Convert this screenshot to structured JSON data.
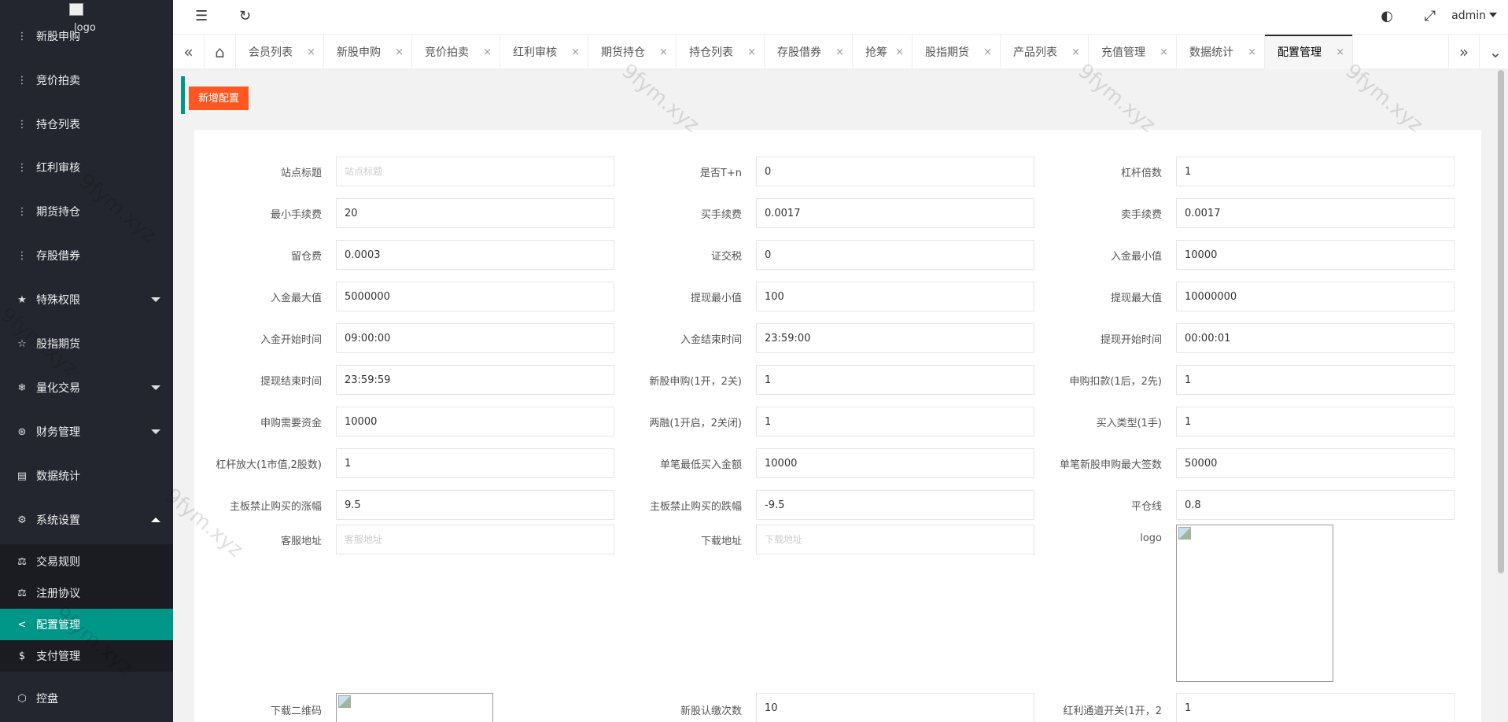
{
  "logo": {
    "alt": "logo"
  },
  "sidebar": {
    "items": [
      {
        "label": "新股申购",
        "icon": "dots-icon"
      },
      {
        "label": "竞价拍卖",
        "icon": "dots-icon"
      },
      {
        "label": "持仓列表",
        "icon": "dots-icon"
      },
      {
        "label": "红利审核",
        "icon": "dots-icon"
      },
      {
        "label": "期货持仓",
        "icon": "dots-icon"
      },
      {
        "label": "存股借券",
        "icon": "dots-icon"
      },
      {
        "label": "特殊权限",
        "icon": "star-icon"
      },
      {
        "label": "股指期货",
        "icon": "star-outline-icon"
      },
      {
        "label": "量化交易",
        "icon": "snowflake-icon"
      },
      {
        "label": "财务管理",
        "icon": "finance-icon"
      },
      {
        "label": "数据统计",
        "icon": "calendar-icon"
      },
      {
        "label": "系统设置",
        "icon": "gear-icon"
      },
      {
        "label": "控盘",
        "icon": "cube-icon"
      }
    ],
    "sub_items": [
      {
        "label": "交易规则",
        "icon": "rule-icon"
      },
      {
        "label": "注册协议",
        "icon": "agreement-icon"
      },
      {
        "label": "配置管理",
        "icon": "share-icon"
      },
      {
        "label": "支付管理",
        "icon": "dollar-icon"
      }
    ]
  },
  "header": {
    "user": "admin"
  },
  "tabs": [
    "会员列表",
    "新股申购",
    "竞价拍卖",
    "红利审核",
    "期货持仓",
    "持仓列表",
    "存股借券",
    "抢筹",
    "股指期货",
    "产品列表",
    "充值管理",
    "数据统计",
    "配置管理"
  ],
  "tab_close": "×",
  "toolbar": {
    "add_label": "新增配置"
  },
  "form": {
    "rows": [
      [
        {
          "label": "站点标题",
          "value": "",
          "placeholder": "站点标题"
        },
        {
          "label": "是否T+n",
          "value": "0"
        },
        {
          "label": "杠杆倍数",
          "value": "1"
        }
      ],
      [
        {
          "label": "最小手续费",
          "value": "20"
        },
        {
          "label": "买手续费",
          "value": "0.0017"
        },
        {
          "label": "卖手续费",
          "value": "0.0017"
        }
      ],
      [
        {
          "label": "留仓费",
          "value": "0.0003"
        },
        {
          "label": "证交税",
          "value": "0"
        },
        {
          "label": "入金最小值",
          "value": "10000"
        }
      ],
      [
        {
          "label": "入金最大值",
          "value": "5000000"
        },
        {
          "label": "提现最小值",
          "value": "100"
        },
        {
          "label": "提现最大值",
          "value": "10000000"
        }
      ],
      [
        {
          "label": "入金开始时间",
          "value": "09:00:00"
        },
        {
          "label": "入金结束时间",
          "value": "23:59:00"
        },
        {
          "label": "提现开始时间",
          "value": "00:00:01"
        }
      ],
      [
        {
          "label": "提现结束时间",
          "value": "23:59:59"
        },
        {
          "label": "新股申购(1开，2关)",
          "value": "1"
        },
        {
          "label": "申购扣款(1后，2先)",
          "value": "1"
        }
      ],
      [
        {
          "label": "申购需要资金",
          "value": "10000"
        },
        {
          "label": "两融(1开启，2关闭)",
          "value": "1"
        },
        {
          "label": "买入类型(1手)",
          "value": "1"
        }
      ],
      [
        {
          "label": "杠杆放大(1市值,2股数)",
          "value": "1"
        },
        {
          "label": "单笔最低买入金额",
          "value": "10000"
        },
        {
          "label": "单笔新股申购最大签数",
          "value": "50000"
        }
      ],
      [
        {
          "label": "主板禁止购买的涨幅",
          "value": "9.5"
        },
        {
          "label": "主板禁止购买的跌幅",
          "value": "-9.5"
        },
        {
          "label": "平仓线",
          "value": "0.8"
        }
      ]
    ],
    "service_url": {
      "label": "客服地址",
      "value": "",
      "placeholder": "客服地址"
    },
    "download_url": {
      "label": "下载地址",
      "value": "",
      "placeholder": "下载地址"
    },
    "logo_label": "logo",
    "qr_label": "下载二维码",
    "ipo_count": {
      "label": "新股认缴次数",
      "value": "10"
    },
    "dividend_switch": {
      "label": "红利通道开关(1开，2",
      "value": "1"
    }
  },
  "watermark": "9fym.xyz"
}
